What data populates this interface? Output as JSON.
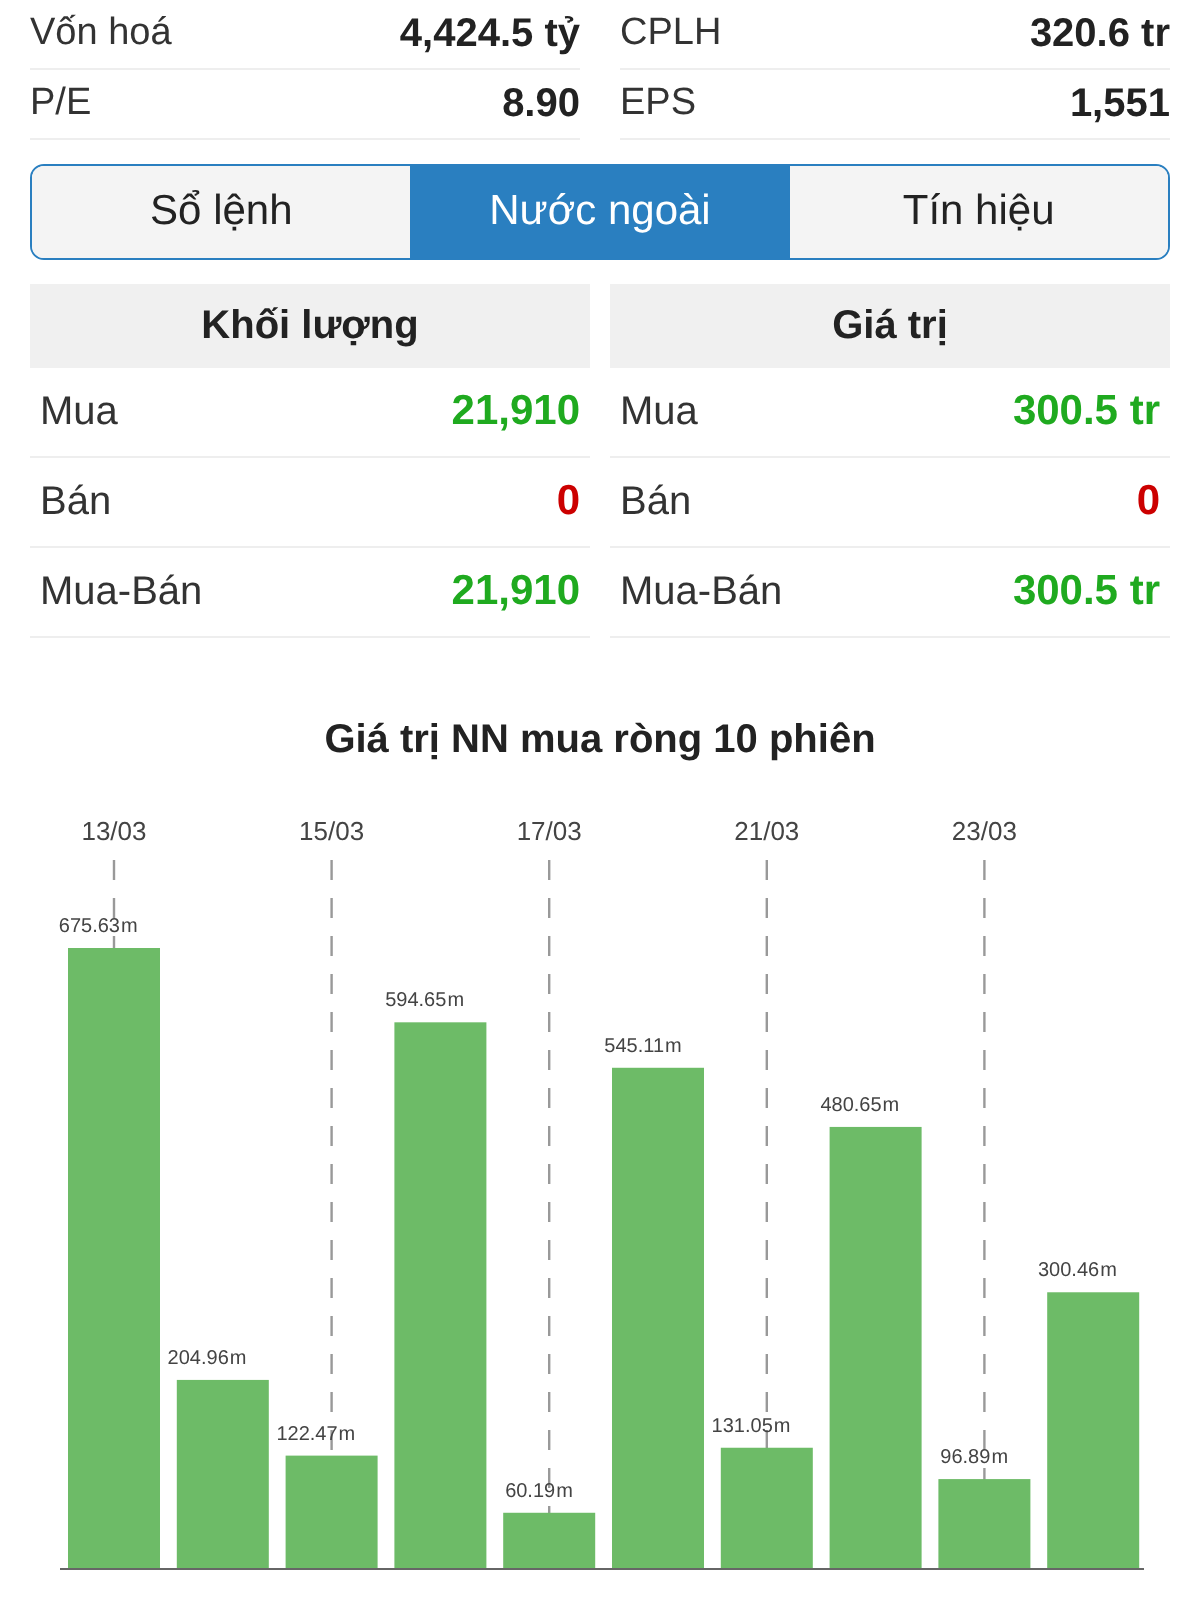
{
  "stats": [
    {
      "label": "Vốn hoá",
      "value": "4,424.5 tỷ"
    },
    {
      "label": "CPLH",
      "value": "320.6 tr"
    },
    {
      "label": "P/E",
      "value": "8.90"
    },
    {
      "label": "EPS",
      "value": "1,551"
    }
  ],
  "tabs": [
    {
      "label": "Sổ lệnh",
      "selected": false
    },
    {
      "label": "Nước ngoài",
      "selected": true
    },
    {
      "label": "Tín hiệu",
      "selected": false
    }
  ],
  "foreign": {
    "columns": [
      "Khối lượng",
      "Giá trị"
    ],
    "rows": [
      {
        "label_1": "Mua",
        "volume": "21,910",
        "label_2": "Mua",
        "value": "300.5 tr",
        "color": "#1faa1f"
      },
      {
        "label_1": "Bán",
        "volume": "0",
        "label_2": "Bán",
        "value": "0",
        "color": "#cc0000"
      },
      {
        "label_1": "Mua-Bán",
        "volume": "21,910",
        "label_2": "Mua-Bán",
        "value": "300.5 tr",
        "color": "#1faa1f"
      }
    ]
  },
  "chart": {
    "chart_data": {
      "type": "bar",
      "title": "Giá trị NN mua ròng 10 phiên",
      "categories": [
        "13/03",
        null,
        "15/03",
        null,
        "17/03",
        null,
        "21/03",
        null,
        "23/03",
        null
      ],
      "series": [
        {
          "color": "#6dbb67",
          "values": [
            675.63,
            204.96,
            122.47,
            594.65,
            60.19,
            545.11,
            131.05,
            480.65,
            96.89,
            300.46
          ]
        }
      ],
      "data_labels": true,
      "grid": true
    },
    "value_units": [
      "m",
      "m",
      "m",
      "m",
      "m",
      "m",
      "m",
      "m",
      "m",
      "m"
    ]
  }
}
